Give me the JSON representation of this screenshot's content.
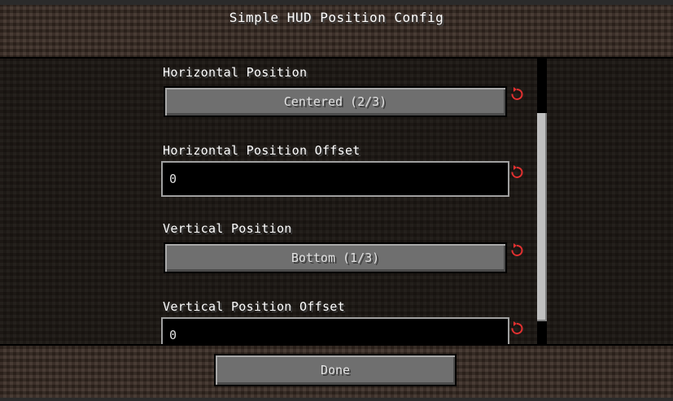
{
  "window": {
    "title": "Simple HUD Position Config"
  },
  "options": [
    {
      "label": "Horizontal Position",
      "control": "button",
      "value": "Centered (2/3)"
    },
    {
      "label": "Horizontal Position Offset",
      "control": "input",
      "value": "0"
    },
    {
      "label": "Vertical Position",
      "control": "button",
      "value": "Bottom (1/3)"
    },
    {
      "label": "Vertical Position Offset",
      "control": "input",
      "value": "0"
    }
  ],
  "reset_icon": {
    "name": "reset-arrow-icon",
    "color": "#e03030"
  },
  "footer": {
    "done_label": "Done"
  },
  "scroll": {
    "position_fraction": 0.19,
    "visible_fraction": 0.73
  }
}
